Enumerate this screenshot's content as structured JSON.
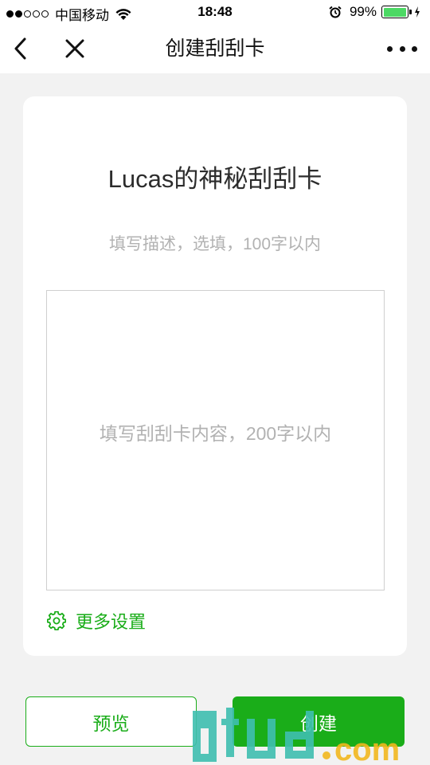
{
  "status_bar": {
    "carrier": "中国移动",
    "time": "18:48",
    "battery_percent": "99%",
    "battery_level": 0.99,
    "icons": [
      "signal-dots",
      "wifi-icon",
      "alarm-icon",
      "battery-icon",
      "charging-icon"
    ]
  },
  "nav": {
    "title": "创建刮刮卡",
    "back_icon": "chevron-left-icon",
    "close_icon": "close-icon",
    "more_icon": "more-dots-icon"
  },
  "card": {
    "title": "Lucas的神秘刮刮卡",
    "description_placeholder": "填写描述，选填，100字以内",
    "description_value": "",
    "content_placeholder": "填写刮刮卡内容，200字以内",
    "content_value": "",
    "more_settings_label": "更多设置",
    "more_settings_icon": "gear-icon"
  },
  "buttons": {
    "preview_label": "预览",
    "create_label": "创建"
  },
  "watermark": {
    "text": "gtud.com"
  },
  "colors": {
    "accent": "#1aad19",
    "background": "#f2f2f2",
    "card": "#ffffff",
    "placeholder": "#b2b2b2",
    "watermark_teal": "#3fbfb0",
    "watermark_yellow": "#f3b81f"
  }
}
